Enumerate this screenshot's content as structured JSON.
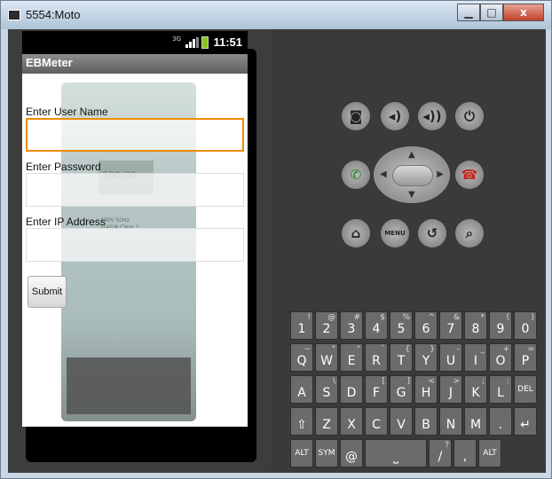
{
  "window": {
    "title": "5554:Moto",
    "min_glyph": "▁",
    "max_glyph": "□",
    "close_glyph": "x"
  },
  "status_bar": {
    "network": "3G",
    "time": "11:51"
  },
  "app": {
    "title": "EBMeter",
    "username_label": "Enter User Name",
    "username_value": "",
    "password_label": "Enter Password",
    "password_value": "",
    "ip_label": "Enter IP Address",
    "ip_value": "",
    "submit_label": "Submit"
  },
  "background_image": {
    "text_lines": [
      "300.00",
      "230V  50Hz",
      "5(40)A  Class 1"
    ]
  },
  "controls": {
    "menu_label": "MENU"
  },
  "keyboard": {
    "row1": [
      [
        "1",
        "!"
      ],
      [
        "2",
        "@"
      ],
      [
        "3",
        "#"
      ],
      [
        "4",
        "$"
      ],
      [
        "5",
        "%"
      ],
      [
        "6",
        "^"
      ],
      [
        "7",
        "&"
      ],
      [
        "8",
        "*"
      ],
      [
        "9",
        "("
      ],
      [
        "0",
        ")"
      ]
    ],
    "row2": [
      [
        "Q",
        "~"
      ],
      [
        "W",
        "\""
      ],
      [
        "E",
        "\""
      ],
      [
        "R",
        "`"
      ],
      [
        "T",
        "{"
      ],
      [
        "Y",
        "}"
      ],
      [
        "U",
        "-"
      ],
      [
        "I",
        "_"
      ],
      [
        "O",
        "+"
      ],
      [
        "P",
        "="
      ]
    ],
    "row3": [
      [
        "A",
        ""
      ],
      [
        "S",
        "\\"
      ],
      [
        "D",
        ""
      ],
      [
        "F",
        "["
      ],
      [
        "G",
        "]"
      ],
      [
        "H",
        "<"
      ],
      [
        "J",
        ">"
      ],
      [
        "K",
        ";"
      ],
      [
        "L",
        ":"
      ],
      [
        "DEL",
        ""
      ]
    ],
    "row4": [
      [
        "⇧",
        ""
      ],
      [
        "Z",
        ""
      ],
      [
        "X",
        ""
      ],
      [
        "C",
        ""
      ],
      [
        "V",
        ""
      ],
      [
        "B",
        ""
      ],
      [
        "N",
        ""
      ],
      [
        "M",
        ""
      ],
      [
        ".",
        ""
      ],
      [
        "↵",
        ""
      ]
    ],
    "row5_left": [
      "ALT",
      "SYM",
      "@"
    ],
    "row5_space": "⎵",
    "row5_right": [
      [
        "/",
        "?"
      ],
      [
        ",",
        ""
      ],
      [
        "ALT",
        ""
      ]
    ]
  }
}
